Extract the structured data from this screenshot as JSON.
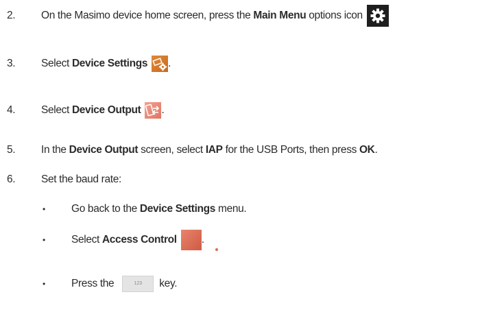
{
  "steps": [
    {
      "num": "2.",
      "pre": "On the Masimo device home screen, press the ",
      "bold": "Main Menu",
      "post": " options icon",
      "icon": "gear-icon"
    },
    {
      "num": "3.",
      "pre": "Select ",
      "bold": "Device Settings",
      "post": ".",
      "icon": "device-settings-icon"
    },
    {
      "num": "4.",
      "pre": "Select ",
      "bold": "Device Output",
      "post": ".",
      "icon": "device-output-icon"
    },
    {
      "num": "5.",
      "text1": "In the ",
      "bold1": "Device Output",
      "text2": " screen, select ",
      "bold2": "IAP",
      "text3": " for the USB Ports, then press ",
      "bold3": "OK",
      "text4": "."
    },
    {
      "num": "6.",
      "text": "Set the baud rate:"
    }
  ],
  "bullets": [
    {
      "symbol": "•",
      "pre": "Go back to the ",
      "bold": "Device Settings",
      "post": " menu."
    },
    {
      "symbol": "•",
      "pre": "Select ",
      "bold": "Access Control",
      "post": ".",
      "icon": "key-icon"
    },
    {
      "symbol": "•",
      "pre": "Press the ",
      "key_label": "123",
      "post": "key."
    }
  ]
}
